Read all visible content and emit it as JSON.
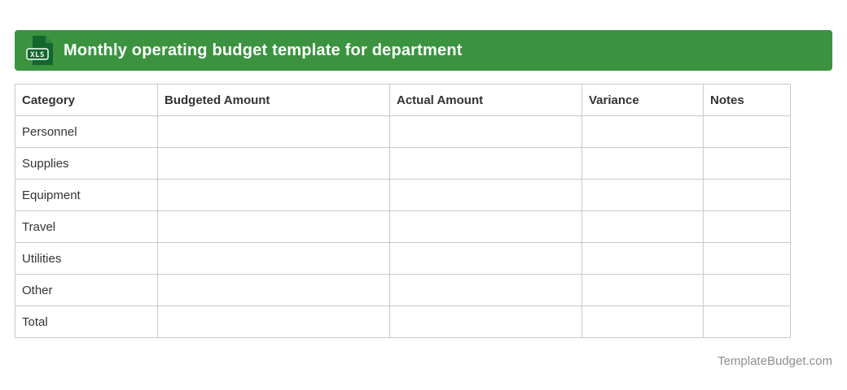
{
  "header": {
    "title": "Monthly operating budget template for department",
    "file_badge": "XLS"
  },
  "colors": {
    "header_bar": "#3B933F",
    "icon_dark_green": "#11672E",
    "table_border": "#C9C9C9",
    "body_text": "#333333",
    "footer_text": "#8D8D8D"
  },
  "table": {
    "columns": [
      "Category",
      "Budgeted Amount",
      "Actual Amount",
      "Variance",
      "Notes"
    ],
    "rows": [
      [
        "Personnel",
        "",
        "",
        "",
        ""
      ],
      [
        "Supplies",
        "",
        "",
        "",
        ""
      ],
      [
        "Equipment",
        "",
        "",
        "",
        ""
      ],
      [
        "Travel",
        "",
        "",
        "",
        ""
      ],
      [
        "Utilities",
        "",
        "",
        "",
        ""
      ],
      [
        "Other",
        "",
        "",
        "",
        ""
      ],
      [
        "Total",
        "",
        "",
        "",
        ""
      ]
    ]
  },
  "footer": {
    "site": "TemplateBudget.com"
  }
}
